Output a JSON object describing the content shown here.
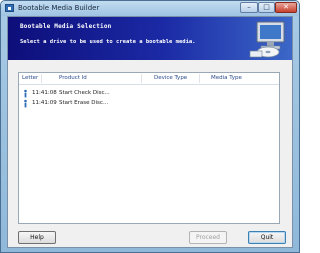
{
  "window": {
    "title": "Bootable Media Builder",
    "minimize_glyph": "–",
    "maximize_glyph": "□",
    "close_glyph": "✕"
  },
  "banner": {
    "title": "Bootable Media Selection",
    "subtitle": "Select a drive to be used to create a bootable media."
  },
  "list": {
    "columns": [
      "Letter",
      "Product Id",
      "Device Type",
      "Media Type"
    ],
    "rows": [
      {
        "icon": "info-icon",
        "time": "11:41:08",
        "text": "Start Check Disc..."
      },
      {
        "icon": "info-icon",
        "time": "11:41:09",
        "text": "Start Erase Disc..."
      }
    ]
  },
  "buttons": {
    "help": "Help",
    "proceed": "Proceed",
    "quit": "Quit"
  },
  "colors": {
    "banner_start": "#0d0e7a",
    "banner_end": "#3c67c8",
    "column_header_text": "#2a4a8a"
  }
}
